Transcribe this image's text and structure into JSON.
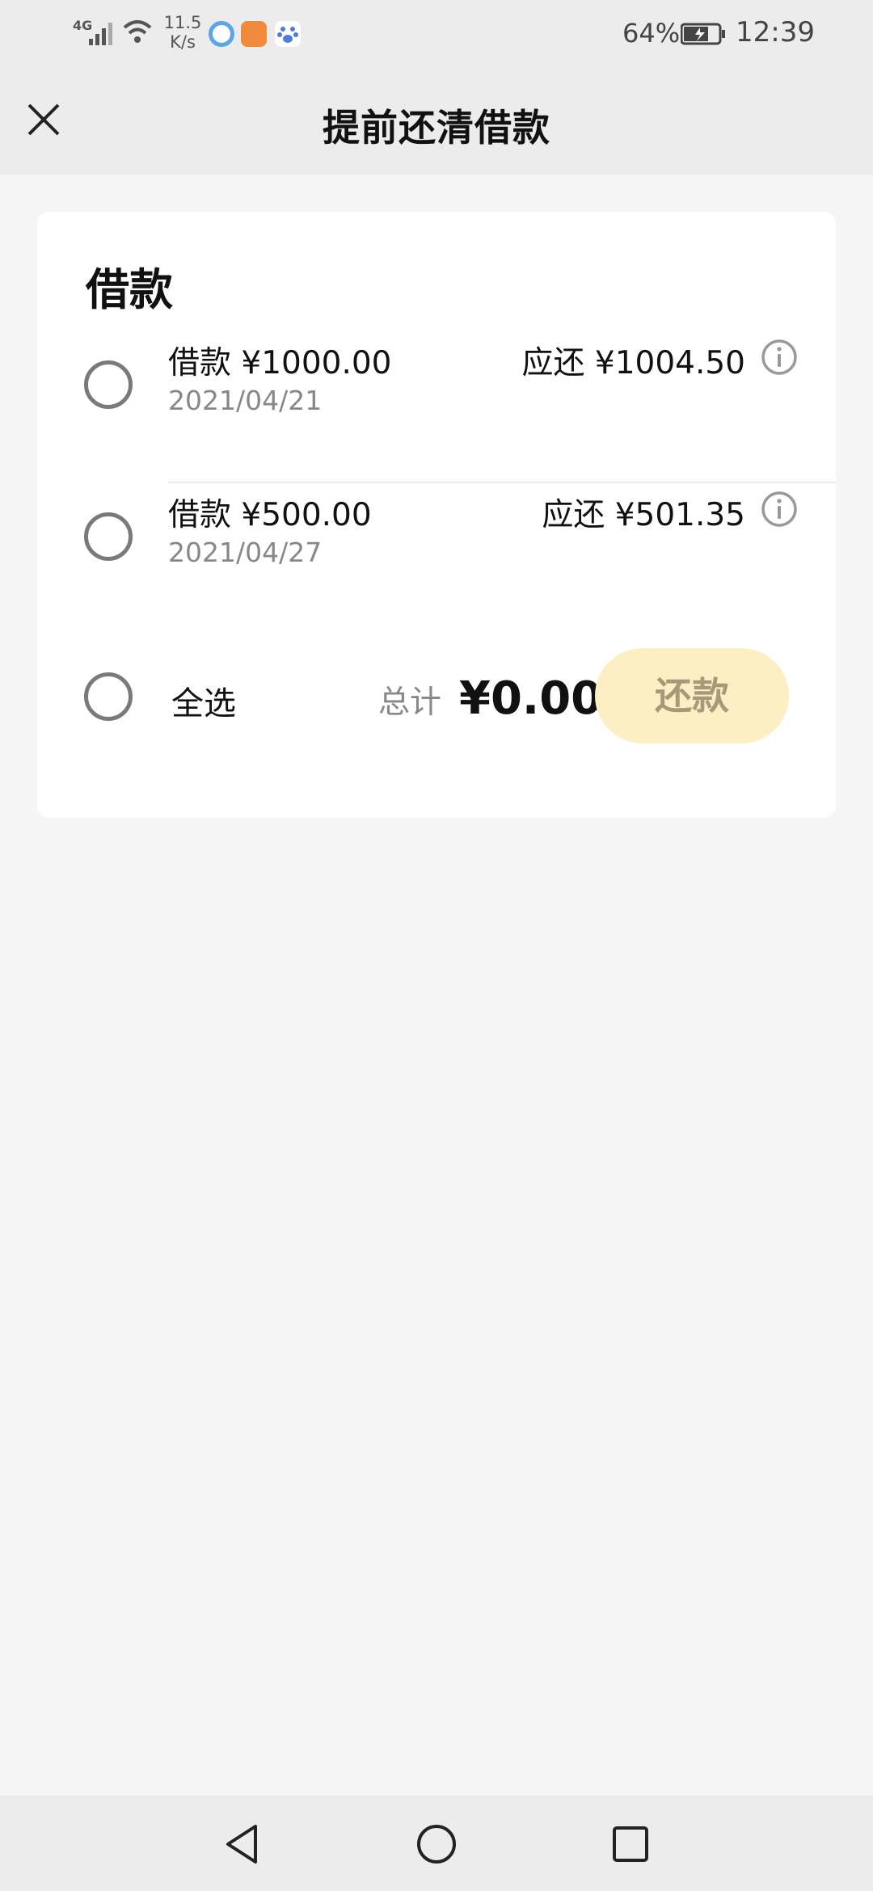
{
  "status_bar": {
    "network": "4G",
    "speed": "11.5\nK/s",
    "battery_percent": "64%",
    "time": "12:39"
  },
  "header": {
    "title": "提前还清借款"
  },
  "loans": {
    "section_title": "借款",
    "items": [
      {
        "amount": "借款 ¥1000.00",
        "date": "2021/04/21",
        "due": "应还 ¥1004.50"
      },
      {
        "amount": "借款 ¥500.00",
        "date": "2021/04/27",
        "due": "应还 ¥501.35"
      }
    ]
  },
  "footer": {
    "select_all": "全选",
    "total_label": "总计",
    "total_value": "¥0.00",
    "repay_button": "还款"
  },
  "colors": {
    "accent_button_bg": "#fdefc4",
    "accent_button_text": "#a69a7a"
  }
}
